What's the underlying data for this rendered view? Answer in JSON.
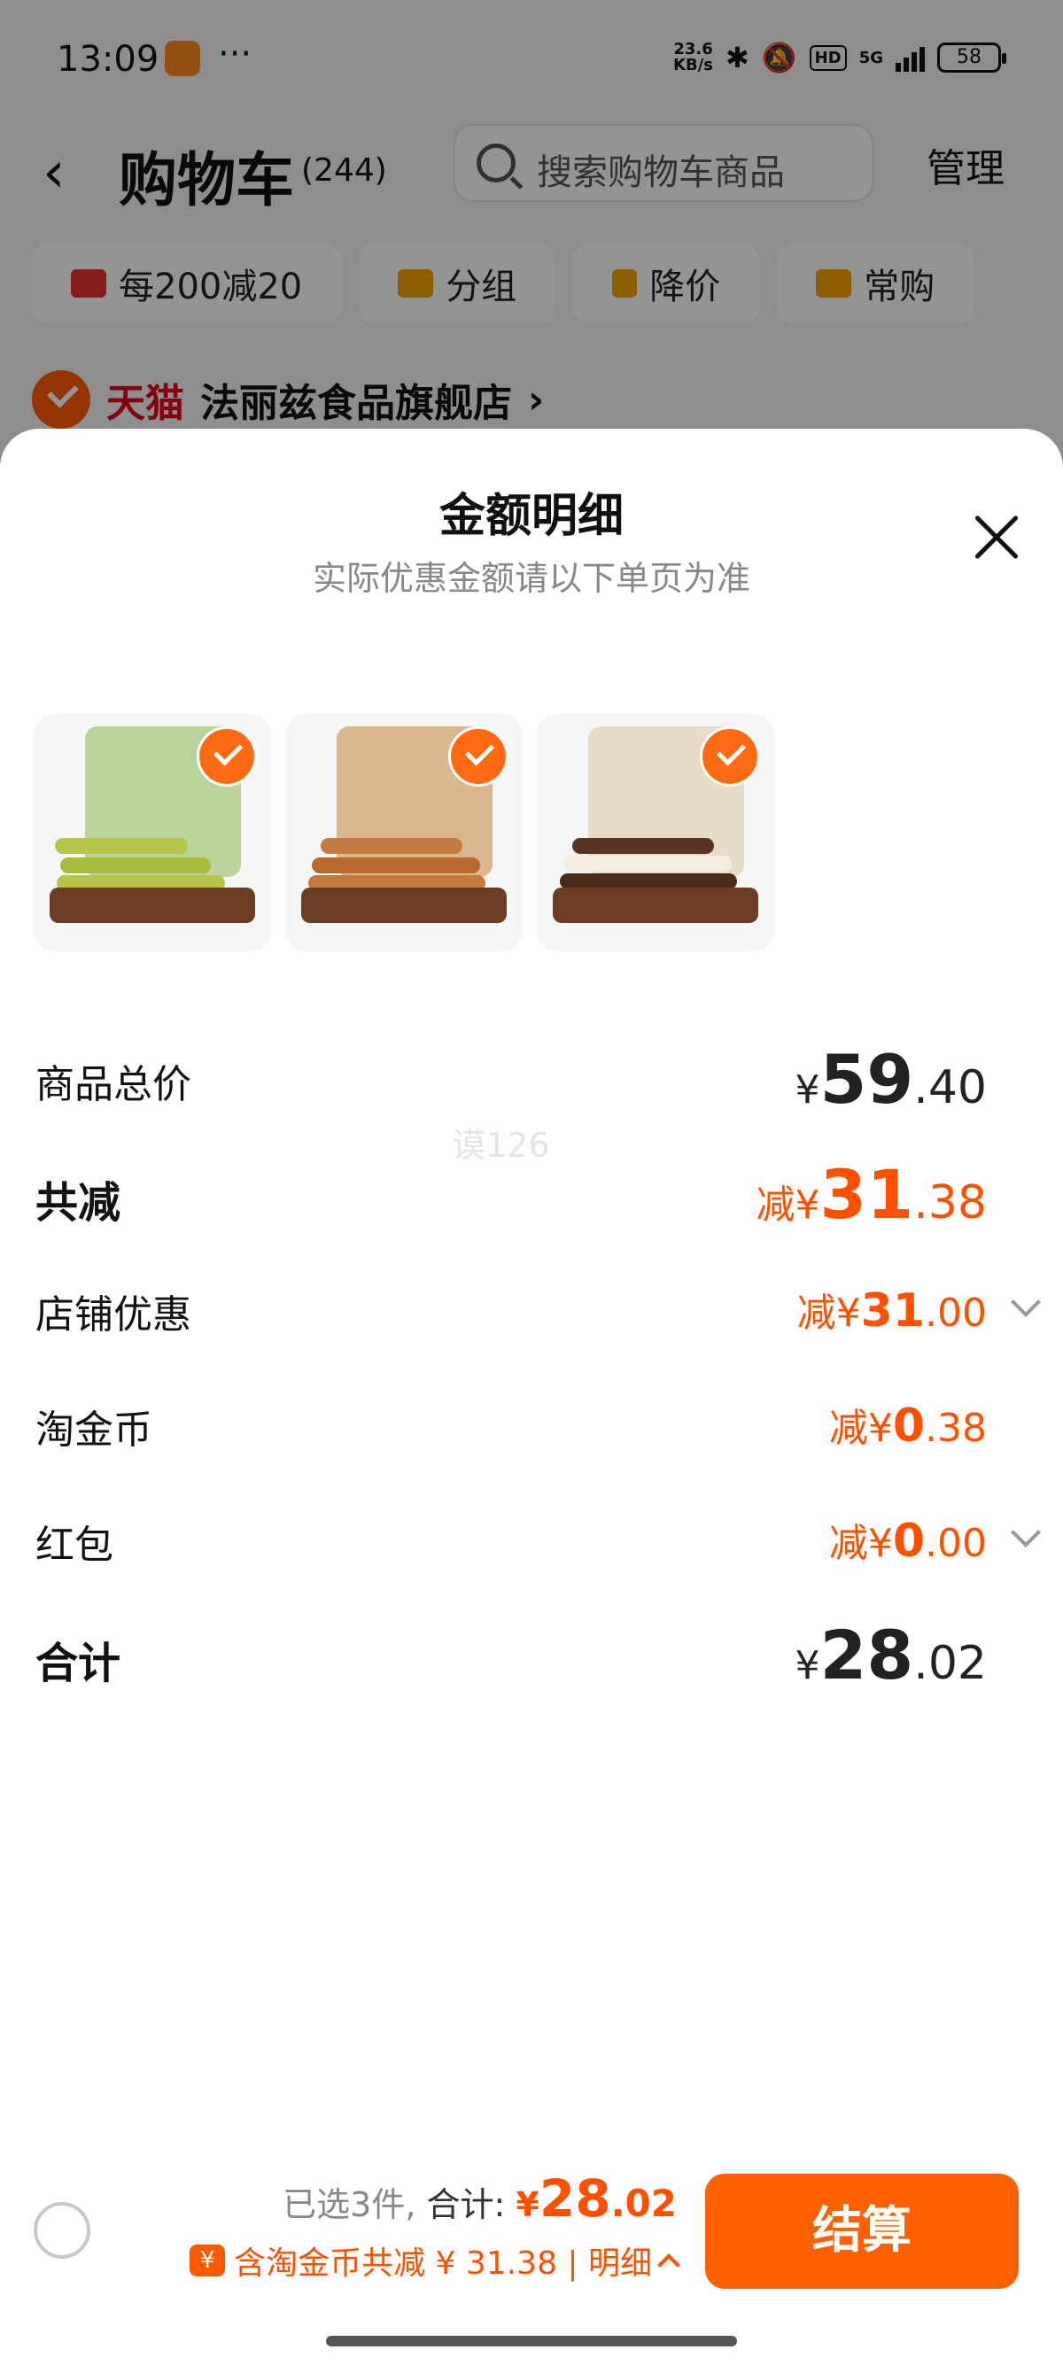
{
  "status_bar": {
    "time": "13:09",
    "dots": "···",
    "net_speed_value": "23.6",
    "net_speed_unit": "KB/s",
    "hd": "HD",
    "network": "5G",
    "battery": "58"
  },
  "nav": {
    "back": "‹",
    "title": "购物车",
    "count": "(244)",
    "search_placeholder": "搜索购物车商品",
    "manage": "管理"
  },
  "chips": [
    {
      "label": "每200减20",
      "color": "#e5322d"
    },
    {
      "label": "分组",
      "color": "#f2a300"
    },
    {
      "label": "降价",
      "color": "#f2a300"
    },
    {
      "label": "常购",
      "color": "#f2a300"
    }
  ],
  "store": {
    "badge": "天猫",
    "name": "法丽兹食品旗舰店",
    "arrow": "›"
  },
  "sheet": {
    "title": "金额明细",
    "subtitle": "实际优惠金额请以下单页为准",
    "watermark": "谟126",
    "rows": {
      "total": {
        "label": "商品总价",
        "prefix": "¥",
        "int": "59",
        "dec": ".40"
      },
      "reduced": {
        "label": "共减",
        "prefix": "减¥",
        "int": "31",
        "dec": ".38"
      },
      "shop": {
        "label": "店铺优惠",
        "prefix": "减¥",
        "int": "31",
        "dec": ".00"
      },
      "coin": {
        "label": "淘金币",
        "prefix": "减¥",
        "int": "0",
        "dec": ".38"
      },
      "redpacket": {
        "label": "红包",
        "prefix": "减¥",
        "int": "0",
        "dec": ".00"
      },
      "sum": {
        "label": "合计",
        "prefix": "¥",
        "int": "28",
        "dec": ".02"
      }
    }
  },
  "bottom": {
    "selected": "已选3件,",
    "sum_label": "合计:",
    "sum_prefix": "¥",
    "sum_int": "28",
    "sum_dec": ".02",
    "coin_icon": "¥",
    "coin_text": "含淘金币共减 ¥ 31.38 | 明细",
    "checkout": "结算"
  },
  "colors": {
    "accent": "#ff5000",
    "button": "#ff6000"
  }
}
